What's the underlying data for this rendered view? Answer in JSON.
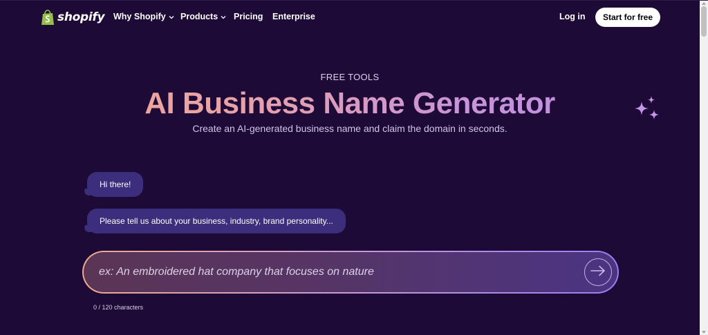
{
  "nav": {
    "logo_text": "shopify",
    "items": [
      {
        "label": "Why Shopify",
        "has_dropdown": true
      },
      {
        "label": "Products",
        "has_dropdown": true
      },
      {
        "label": "Pricing",
        "has_dropdown": false
      },
      {
        "label": "Enterprise",
        "has_dropdown": false
      }
    ],
    "login_label": "Log in",
    "cta_label": "Start for free",
    "dropdown_icon": "chevron-down-icon"
  },
  "hero": {
    "eyebrow": "FREE TOOLS",
    "title": "AI Business Name Generator",
    "subtitle": "Create an AI-generated business name and claim the domain in seconds.",
    "decoration_icon": "sparkle-icon"
  },
  "chat": {
    "messages": [
      "Hi there!",
      "Please tell us about your business, industry, brand personality..."
    ]
  },
  "prompt": {
    "placeholder": "ex: An embroidered hat company that focuses on nature",
    "value": "",
    "submit_icon": "arrow-right-icon",
    "counter": "0 / 120 characters"
  },
  "colors": {
    "background": "#1e0a36",
    "bubble": "#3c2e7c",
    "gradient_start": "#f0a98c",
    "gradient_end": "#b98ce8",
    "logo_green": "#95bf47"
  }
}
